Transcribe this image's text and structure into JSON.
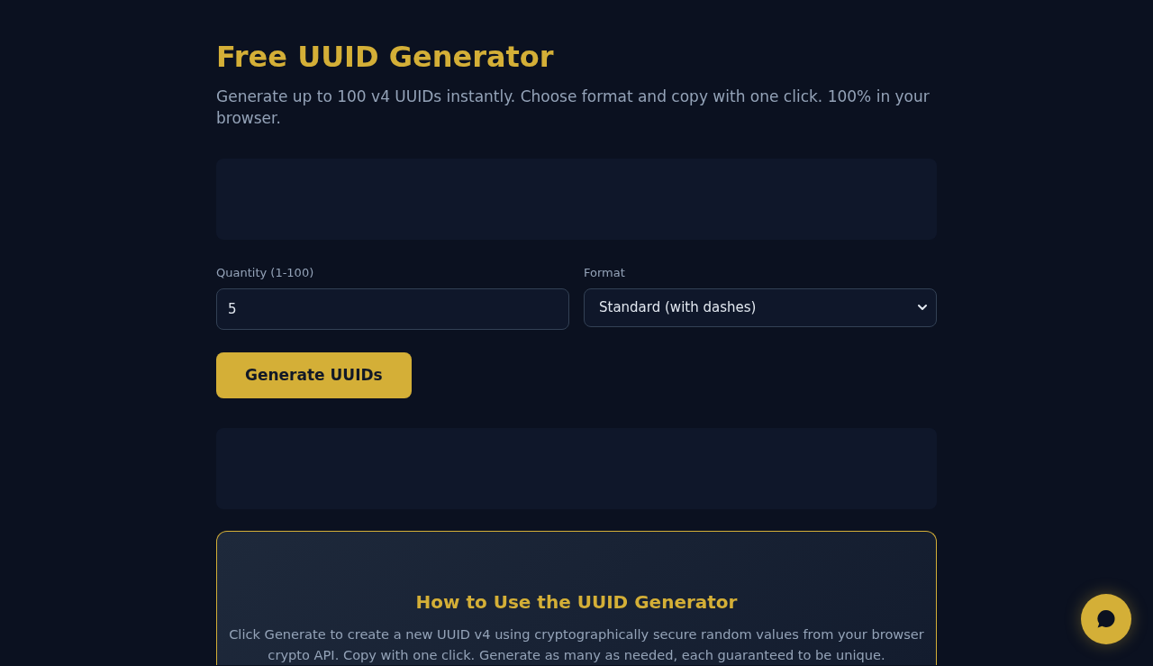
{
  "header": {
    "title": "Free UUID Generator",
    "subtitle": "Generate up to 100 v4 UUIDs instantly. Choose format and copy with one click. 100% in your browser."
  },
  "form": {
    "quantity": {
      "label": "Quantity (1-100)",
      "value": "5"
    },
    "format": {
      "label": "Format",
      "value": "Standard (with dashes)"
    },
    "generate_button": "Generate UUIDs"
  },
  "how_to": {
    "title": "How to Use the UUID Generator",
    "text": "Click Generate to create a new UUID v4 using cryptographically secure random values from your browser crypto API. Copy with one click. Generate as many as needed, each guaranteed to be unique."
  }
}
